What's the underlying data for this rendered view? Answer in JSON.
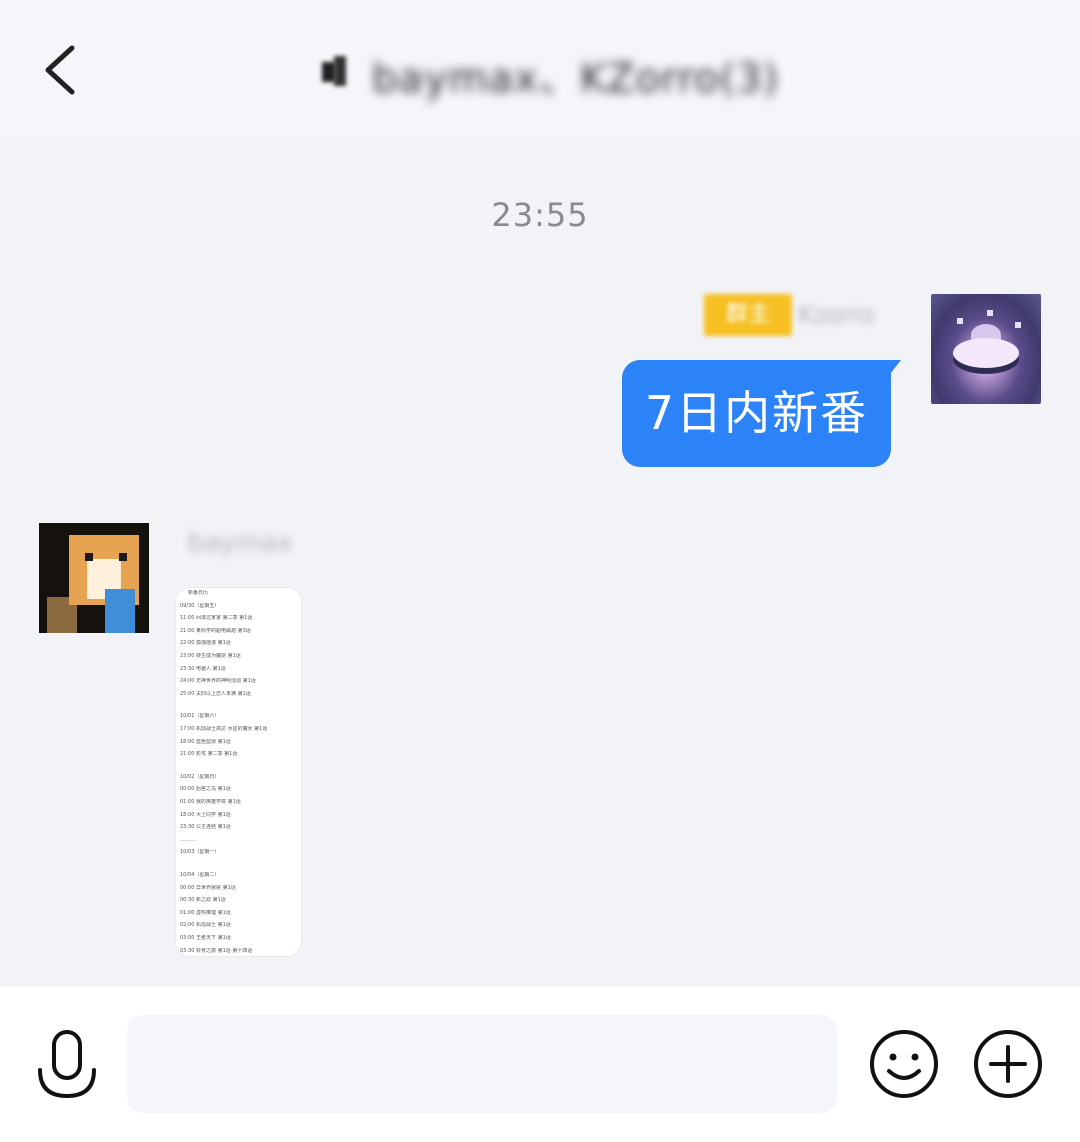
{
  "header": {
    "title": "baymax、KZorro(3)",
    "back_icon": "chevron-left-icon"
  },
  "messages": {
    "timestamp": "23:55",
    "outgoing": {
      "tag": "群主",
      "sender": "Kzorro",
      "text": "7日内新番"
    },
    "incoming": {
      "sender": "baymax",
      "image_lines": [
        "新番日历",
        "09/30（星期五）",
        "11:00 间谍过家家 第二季 第1话",
        "21:00 某科学的超电磁炮 第3话",
        "22:00 孤独摇滚 第1话",
        "23:00 转生成为魔剑 第1话",
        "23:30 电锯人 第1话",
        "24:00 无神世界的神明活动 第1话",
        "25:00 夫妇以上恋人未满 第1话",
        "",
        "10/01（星期六）",
        "17:00 机动战士高达 水星的魔女 第1话",
        "18:00 蓝色监狱 第1话",
        "21:00 影宅 第二季 第1话",
        "",
        "10/02（星期日）",
        "00:00 后宫之乌 第1话",
        "01:00 我的英雄学院 第1话",
        "18:00 大上同学 第1话",
        "23:30 公主连结 第1话",
        "..........",
        "10/03（星期一）",
        "",
        "10/04（星期二）",
        "00:00 异世界舅舅 第1话",
        "00:30 新之助 第1话",
        "01:00 虚构推理 第1话",
        "02:00 机动战士 第1话",
        "03:00 王者天下 第1话",
        "03:30 铃芽之旅 第1话 第十四话"
      ]
    }
  },
  "input_bar": {
    "placeholder": "",
    "mic_icon": "microphone-icon",
    "emoji_icon": "smiley-icon",
    "plus_icon": "plus-circle-icon"
  },
  "colors": {
    "header_bg": "#f5f6fb",
    "chat_bg": "#f2f3f6",
    "bubble_out": "#2c82f7",
    "tag": "#f6c022",
    "timestamp": "#8a8a8f"
  }
}
